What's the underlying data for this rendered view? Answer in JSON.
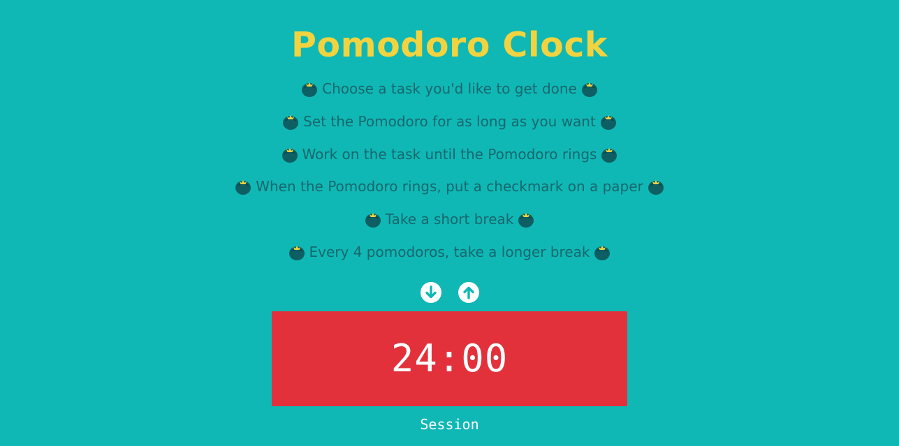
{
  "app": {
    "title": "Pomodoro Clock"
  },
  "steps": [
    {
      "label": "Choose a task you'd like to get done"
    },
    {
      "label": "Set the Pomodoro for as long as you want"
    },
    {
      "label": "Work on the task until the Pomodoro rings"
    },
    {
      "label": "When the Pomodoro rings, put a checkmark on a paper"
    },
    {
      "label": "Take a short break"
    },
    {
      "label": "Every 4 pomodoros, take a longer break"
    }
  ],
  "icons": {
    "step_marker": "tomato-icon",
    "decrement": "arrow-down-circle-icon",
    "increment": "arrow-up-circle-icon"
  },
  "timer": {
    "display": "24:00",
    "label": "Session"
  },
  "colors": {
    "background": "#0fb8b5",
    "title": "#f2d33f",
    "step_text": "#18676d",
    "timer_background": "#e3313b",
    "timer_text": "#ffffff",
    "tomato_body": "#0d5f63",
    "tomato_leaf": "#f2d33f"
  }
}
